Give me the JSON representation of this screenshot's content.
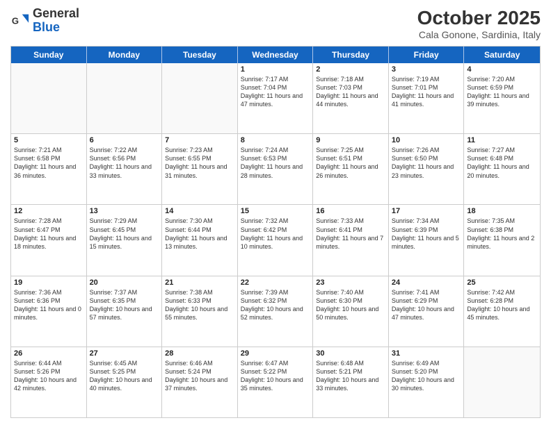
{
  "header": {
    "logo_general": "General",
    "logo_blue": "Blue",
    "month": "October 2025",
    "location": "Cala Gonone, Sardinia, Italy"
  },
  "days": [
    "Sunday",
    "Monday",
    "Tuesday",
    "Wednesday",
    "Thursday",
    "Friday",
    "Saturday"
  ],
  "weeks": [
    [
      {
        "day": "",
        "sunrise": "",
        "sunset": "",
        "daylight": ""
      },
      {
        "day": "",
        "sunrise": "",
        "sunset": "",
        "daylight": ""
      },
      {
        "day": "",
        "sunrise": "",
        "sunset": "",
        "daylight": ""
      },
      {
        "day": "1",
        "sunrise": "Sunrise: 7:17 AM",
        "sunset": "Sunset: 7:04 PM",
        "daylight": "Daylight: 11 hours and 47 minutes."
      },
      {
        "day": "2",
        "sunrise": "Sunrise: 7:18 AM",
        "sunset": "Sunset: 7:03 PM",
        "daylight": "Daylight: 11 hours and 44 minutes."
      },
      {
        "day": "3",
        "sunrise": "Sunrise: 7:19 AM",
        "sunset": "Sunset: 7:01 PM",
        "daylight": "Daylight: 11 hours and 41 minutes."
      },
      {
        "day": "4",
        "sunrise": "Sunrise: 7:20 AM",
        "sunset": "Sunset: 6:59 PM",
        "daylight": "Daylight: 11 hours and 39 minutes."
      }
    ],
    [
      {
        "day": "5",
        "sunrise": "Sunrise: 7:21 AM",
        "sunset": "Sunset: 6:58 PM",
        "daylight": "Daylight: 11 hours and 36 minutes."
      },
      {
        "day": "6",
        "sunrise": "Sunrise: 7:22 AM",
        "sunset": "Sunset: 6:56 PM",
        "daylight": "Daylight: 11 hours and 33 minutes."
      },
      {
        "day": "7",
        "sunrise": "Sunrise: 7:23 AM",
        "sunset": "Sunset: 6:55 PM",
        "daylight": "Daylight: 11 hours and 31 minutes."
      },
      {
        "day": "8",
        "sunrise": "Sunrise: 7:24 AM",
        "sunset": "Sunset: 6:53 PM",
        "daylight": "Daylight: 11 hours and 28 minutes."
      },
      {
        "day": "9",
        "sunrise": "Sunrise: 7:25 AM",
        "sunset": "Sunset: 6:51 PM",
        "daylight": "Daylight: 11 hours and 26 minutes."
      },
      {
        "day": "10",
        "sunrise": "Sunrise: 7:26 AM",
        "sunset": "Sunset: 6:50 PM",
        "daylight": "Daylight: 11 hours and 23 minutes."
      },
      {
        "day": "11",
        "sunrise": "Sunrise: 7:27 AM",
        "sunset": "Sunset: 6:48 PM",
        "daylight": "Daylight: 11 hours and 20 minutes."
      }
    ],
    [
      {
        "day": "12",
        "sunrise": "Sunrise: 7:28 AM",
        "sunset": "Sunset: 6:47 PM",
        "daylight": "Daylight: 11 hours and 18 minutes."
      },
      {
        "day": "13",
        "sunrise": "Sunrise: 7:29 AM",
        "sunset": "Sunset: 6:45 PM",
        "daylight": "Daylight: 11 hours and 15 minutes."
      },
      {
        "day": "14",
        "sunrise": "Sunrise: 7:30 AM",
        "sunset": "Sunset: 6:44 PM",
        "daylight": "Daylight: 11 hours and 13 minutes."
      },
      {
        "day": "15",
        "sunrise": "Sunrise: 7:32 AM",
        "sunset": "Sunset: 6:42 PM",
        "daylight": "Daylight: 11 hours and 10 minutes."
      },
      {
        "day": "16",
        "sunrise": "Sunrise: 7:33 AM",
        "sunset": "Sunset: 6:41 PM",
        "daylight": "Daylight: 11 hours and 7 minutes."
      },
      {
        "day": "17",
        "sunrise": "Sunrise: 7:34 AM",
        "sunset": "Sunset: 6:39 PM",
        "daylight": "Daylight: 11 hours and 5 minutes."
      },
      {
        "day": "18",
        "sunrise": "Sunrise: 7:35 AM",
        "sunset": "Sunset: 6:38 PM",
        "daylight": "Daylight: 11 hours and 2 minutes."
      }
    ],
    [
      {
        "day": "19",
        "sunrise": "Sunrise: 7:36 AM",
        "sunset": "Sunset: 6:36 PM",
        "daylight": "Daylight: 11 hours and 0 minutes."
      },
      {
        "day": "20",
        "sunrise": "Sunrise: 7:37 AM",
        "sunset": "Sunset: 6:35 PM",
        "daylight": "Daylight: 10 hours and 57 minutes."
      },
      {
        "day": "21",
        "sunrise": "Sunrise: 7:38 AM",
        "sunset": "Sunset: 6:33 PM",
        "daylight": "Daylight: 10 hours and 55 minutes."
      },
      {
        "day": "22",
        "sunrise": "Sunrise: 7:39 AM",
        "sunset": "Sunset: 6:32 PM",
        "daylight": "Daylight: 10 hours and 52 minutes."
      },
      {
        "day": "23",
        "sunrise": "Sunrise: 7:40 AM",
        "sunset": "Sunset: 6:30 PM",
        "daylight": "Daylight: 10 hours and 50 minutes."
      },
      {
        "day": "24",
        "sunrise": "Sunrise: 7:41 AM",
        "sunset": "Sunset: 6:29 PM",
        "daylight": "Daylight: 10 hours and 47 minutes."
      },
      {
        "day": "25",
        "sunrise": "Sunrise: 7:42 AM",
        "sunset": "Sunset: 6:28 PM",
        "daylight": "Daylight: 10 hours and 45 minutes."
      }
    ],
    [
      {
        "day": "26",
        "sunrise": "Sunrise: 6:44 AM",
        "sunset": "Sunset: 5:26 PM",
        "daylight": "Daylight: 10 hours and 42 minutes."
      },
      {
        "day": "27",
        "sunrise": "Sunrise: 6:45 AM",
        "sunset": "Sunset: 5:25 PM",
        "daylight": "Daylight: 10 hours and 40 minutes."
      },
      {
        "day": "28",
        "sunrise": "Sunrise: 6:46 AM",
        "sunset": "Sunset: 5:24 PM",
        "daylight": "Daylight: 10 hours and 37 minutes."
      },
      {
        "day": "29",
        "sunrise": "Sunrise: 6:47 AM",
        "sunset": "Sunset: 5:22 PM",
        "daylight": "Daylight: 10 hours and 35 minutes."
      },
      {
        "day": "30",
        "sunrise": "Sunrise: 6:48 AM",
        "sunset": "Sunset: 5:21 PM",
        "daylight": "Daylight: 10 hours and 33 minutes."
      },
      {
        "day": "31",
        "sunrise": "Sunrise: 6:49 AM",
        "sunset": "Sunset: 5:20 PM",
        "daylight": "Daylight: 10 hours and 30 minutes."
      },
      {
        "day": "",
        "sunrise": "",
        "sunset": "",
        "daylight": ""
      }
    ]
  ]
}
